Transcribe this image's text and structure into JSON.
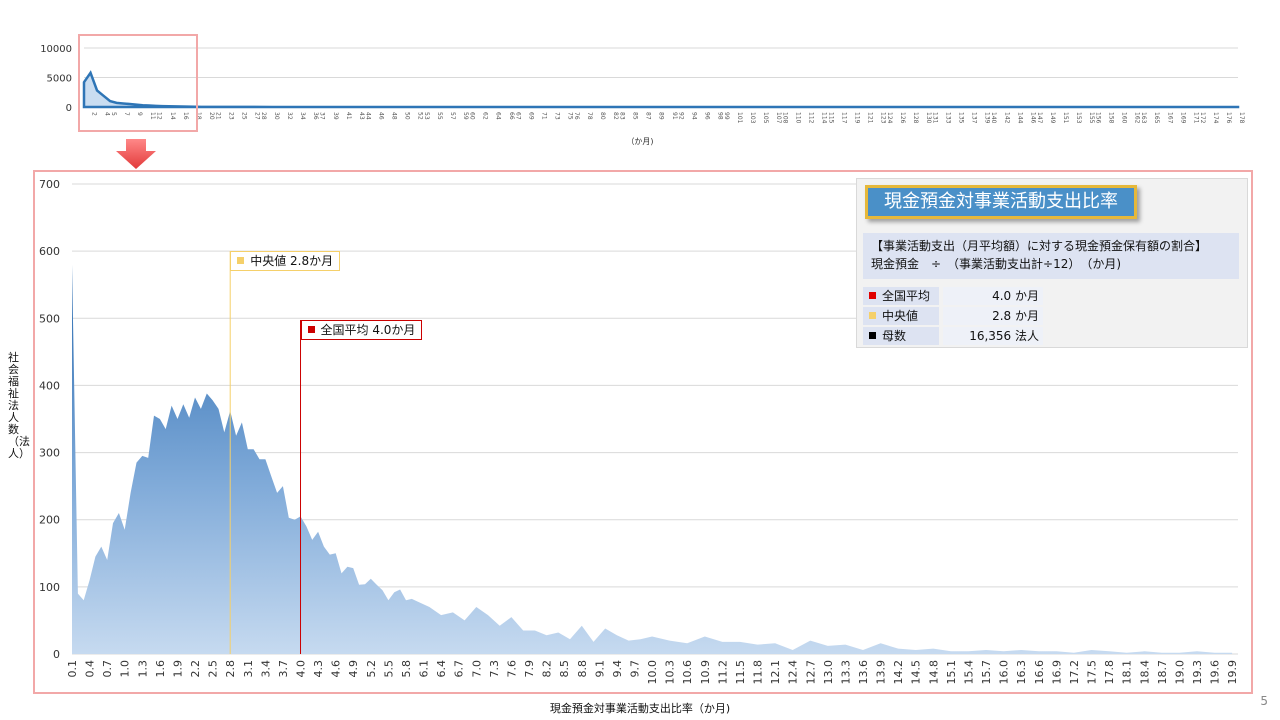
{
  "page_number": "5",
  "info": {
    "title": "現金預金対事業活動支出比率",
    "desc_line1": "【事業活動支出（月平均額）に対する現金預金保有額の割合】",
    "desc_line2": "現金預金　÷　（事業活動支出計÷12）　（か月)",
    "stats": [
      {
        "label": "全国平均",
        "value": "4.0 か月",
        "color": "#e00000"
      },
      {
        "label": "中央値",
        "value": "2.8 か月",
        "color": "#f5d06a"
      },
      {
        "label": "母数",
        "value": "16,356 法人",
        "color": "#000000"
      }
    ]
  },
  "callouts": {
    "median": "中央値  2.8か月",
    "average": "全国平均  4.0か月"
  },
  "chart_data": [
    {
      "type": "area",
      "name": "overview",
      "ylim": [
        0,
        10000
      ],
      "yticks": [
        0,
        5000,
        10000
      ],
      "xlabel": "（か月)",
      "x_ticks": [
        2,
        4,
        5,
        7,
        9,
        11,
        12,
        14,
        16,
        18,
        20,
        21,
        23,
        25,
        27,
        28,
        30,
        32,
        34,
        36,
        37,
        39,
        41,
        43,
        44,
        46,
        48,
        50,
        52,
        53,
        55,
        57,
        59,
        60,
        62,
        64,
        66,
        67,
        69,
        71,
        73,
        75,
        76,
        78,
        80,
        82,
        83,
        85,
        87,
        89,
        91,
        92,
        94,
        96,
        98,
        99,
        101,
        103,
        105,
        107,
        108,
        110,
        112,
        114,
        115,
        117,
        119,
        121,
        123,
        124,
        126,
        128,
        130,
        131,
        133,
        135,
        137,
        139,
        140,
        142,
        144,
        146,
        147,
        149,
        151,
        153,
        155,
        156,
        158,
        160,
        162,
        163,
        165,
        167,
        169,
        171,
        172,
        174,
        176,
        178
      ],
      "x": [
        1,
        2,
        3,
        4,
        5,
        6,
        7,
        8,
        9,
        10,
        11,
        12,
        13,
        14,
        15,
        16,
        17,
        18,
        19,
        20,
        30,
        60,
        100,
        140,
        178
      ],
      "values": [
        4200,
        5800,
        2800,
        1900,
        1000,
        700,
        600,
        500,
        400,
        300,
        250,
        200,
        150,
        120,
        100,
        80,
        60,
        40,
        30,
        20,
        10,
        5,
        3,
        2,
        1
      ]
    },
    {
      "type": "area",
      "name": "detail",
      "ylim": [
        0,
        700
      ],
      "yticks": [
        0,
        100,
        200,
        300,
        400,
        500,
        600,
        700
      ],
      "ylabel": "社会福祉法人数（法人）",
      "xlabel": "現金預金対事業活動支出比率（か月)",
      "x_tick_labels": [
        "0.1",
        "0.4",
        "0.7",
        "1.0",
        "1.3",
        "1.6",
        "1.9",
        "2.2",
        "2.5",
        "2.8",
        "3.1",
        "3.4",
        "3.7",
        "4.0",
        "4.3",
        "4.6",
        "4.9",
        "5.2",
        "5.5",
        "5.8",
        "6.1",
        "6.4",
        "6.7",
        "7.0",
        "7.3",
        "7.6",
        "7.9",
        "8.2",
        "8.5",
        "8.8",
        "9.1",
        "9.4",
        "9.7",
        "10.0",
        "10.3",
        "10.6",
        "10.9",
        "11.2",
        "11.5",
        "11.8",
        "12.1",
        "12.4",
        "12.7",
        "13.0",
        "13.3",
        "13.6",
        "13.9",
        "14.2",
        "14.5",
        "14.8",
        "15.1",
        "15.4",
        "15.7",
        "16.0",
        "16.3",
        "16.6",
        "16.9",
        "17.2",
        "17.5",
        "17.8",
        "18.1",
        "18.4",
        "18.7",
        "19.0",
        "19.3",
        "19.6",
        "19.9"
      ],
      "x": [
        0.1,
        0.2,
        0.3,
        0.4,
        0.5,
        0.6,
        0.7,
        0.8,
        0.9,
        1.0,
        1.1,
        1.2,
        1.3,
        1.4,
        1.5,
        1.6,
        1.7,
        1.8,
        1.9,
        2.0,
        2.1,
        2.2,
        2.3,
        2.4,
        2.5,
        2.6,
        2.7,
        2.8,
        2.9,
        3.0,
        3.1,
        3.2,
        3.3,
        3.4,
        3.5,
        3.6,
        3.7,
        3.8,
        3.9,
        4.0,
        4.1,
        4.2,
        4.3,
        4.4,
        4.5,
        4.6,
        4.7,
        4.8,
        4.9,
        5.0,
        5.1,
        5.2,
        5.3,
        5.4,
        5.5,
        5.6,
        5.7,
        5.8,
        5.9,
        6.0,
        6.2,
        6.4,
        6.6,
        6.8,
        7.0,
        7.2,
        7.4,
        7.6,
        7.8,
        8.0,
        8.2,
        8.4,
        8.6,
        8.8,
        9.0,
        9.2,
        9.4,
        9.6,
        9.8,
        10.0,
        10.3,
        10.6,
        10.9,
        11.2,
        11.5,
        11.8,
        12.1,
        12.4,
        12.7,
        13.0,
        13.3,
        13.6,
        13.9,
        14.2,
        14.5,
        14.8,
        15.1,
        15.4,
        15.7,
        16.0,
        16.3,
        16.6,
        16.9,
        17.2,
        17.5,
        17.8,
        18.1,
        18.4,
        18.7,
        19.0,
        19.3,
        19.6,
        19.9
      ],
      "values": [
        580,
        90,
        80,
        110,
        145,
        160,
        140,
        195,
        210,
        185,
        240,
        285,
        295,
        292,
        355,
        350,
        335,
        370,
        350,
        372,
        352,
        382,
        365,
        388,
        378,
        365,
        330,
        362,
        325,
        345,
        305,
        305,
        290,
        290,
        265,
        240,
        250,
        203,
        200,
        205,
        190,
        170,
        182,
        160,
        148,
        150,
        120,
        130,
        128,
        103,
        104,
        112,
        103,
        95,
        80,
        92,
        96,
        80,
        82,
        78,
        70,
        58,
        62,
        50,
        70,
        58,
        42,
        55,
        35,
        35,
        28,
        32,
        22,
        42,
        18,
        38,
        28,
        20,
        22,
        26,
        20,
        16,
        26,
        18,
        18,
        14,
        16,
        6,
        20,
        12,
        14,
        6,
        16,
        8,
        6,
        8,
        4,
        4,
        6,
        4,
        6,
        4,
        4,
        2,
        6,
        4,
        2,
        4,
        2,
        2,
        4,
        2,
        2
      ]
    }
  ]
}
